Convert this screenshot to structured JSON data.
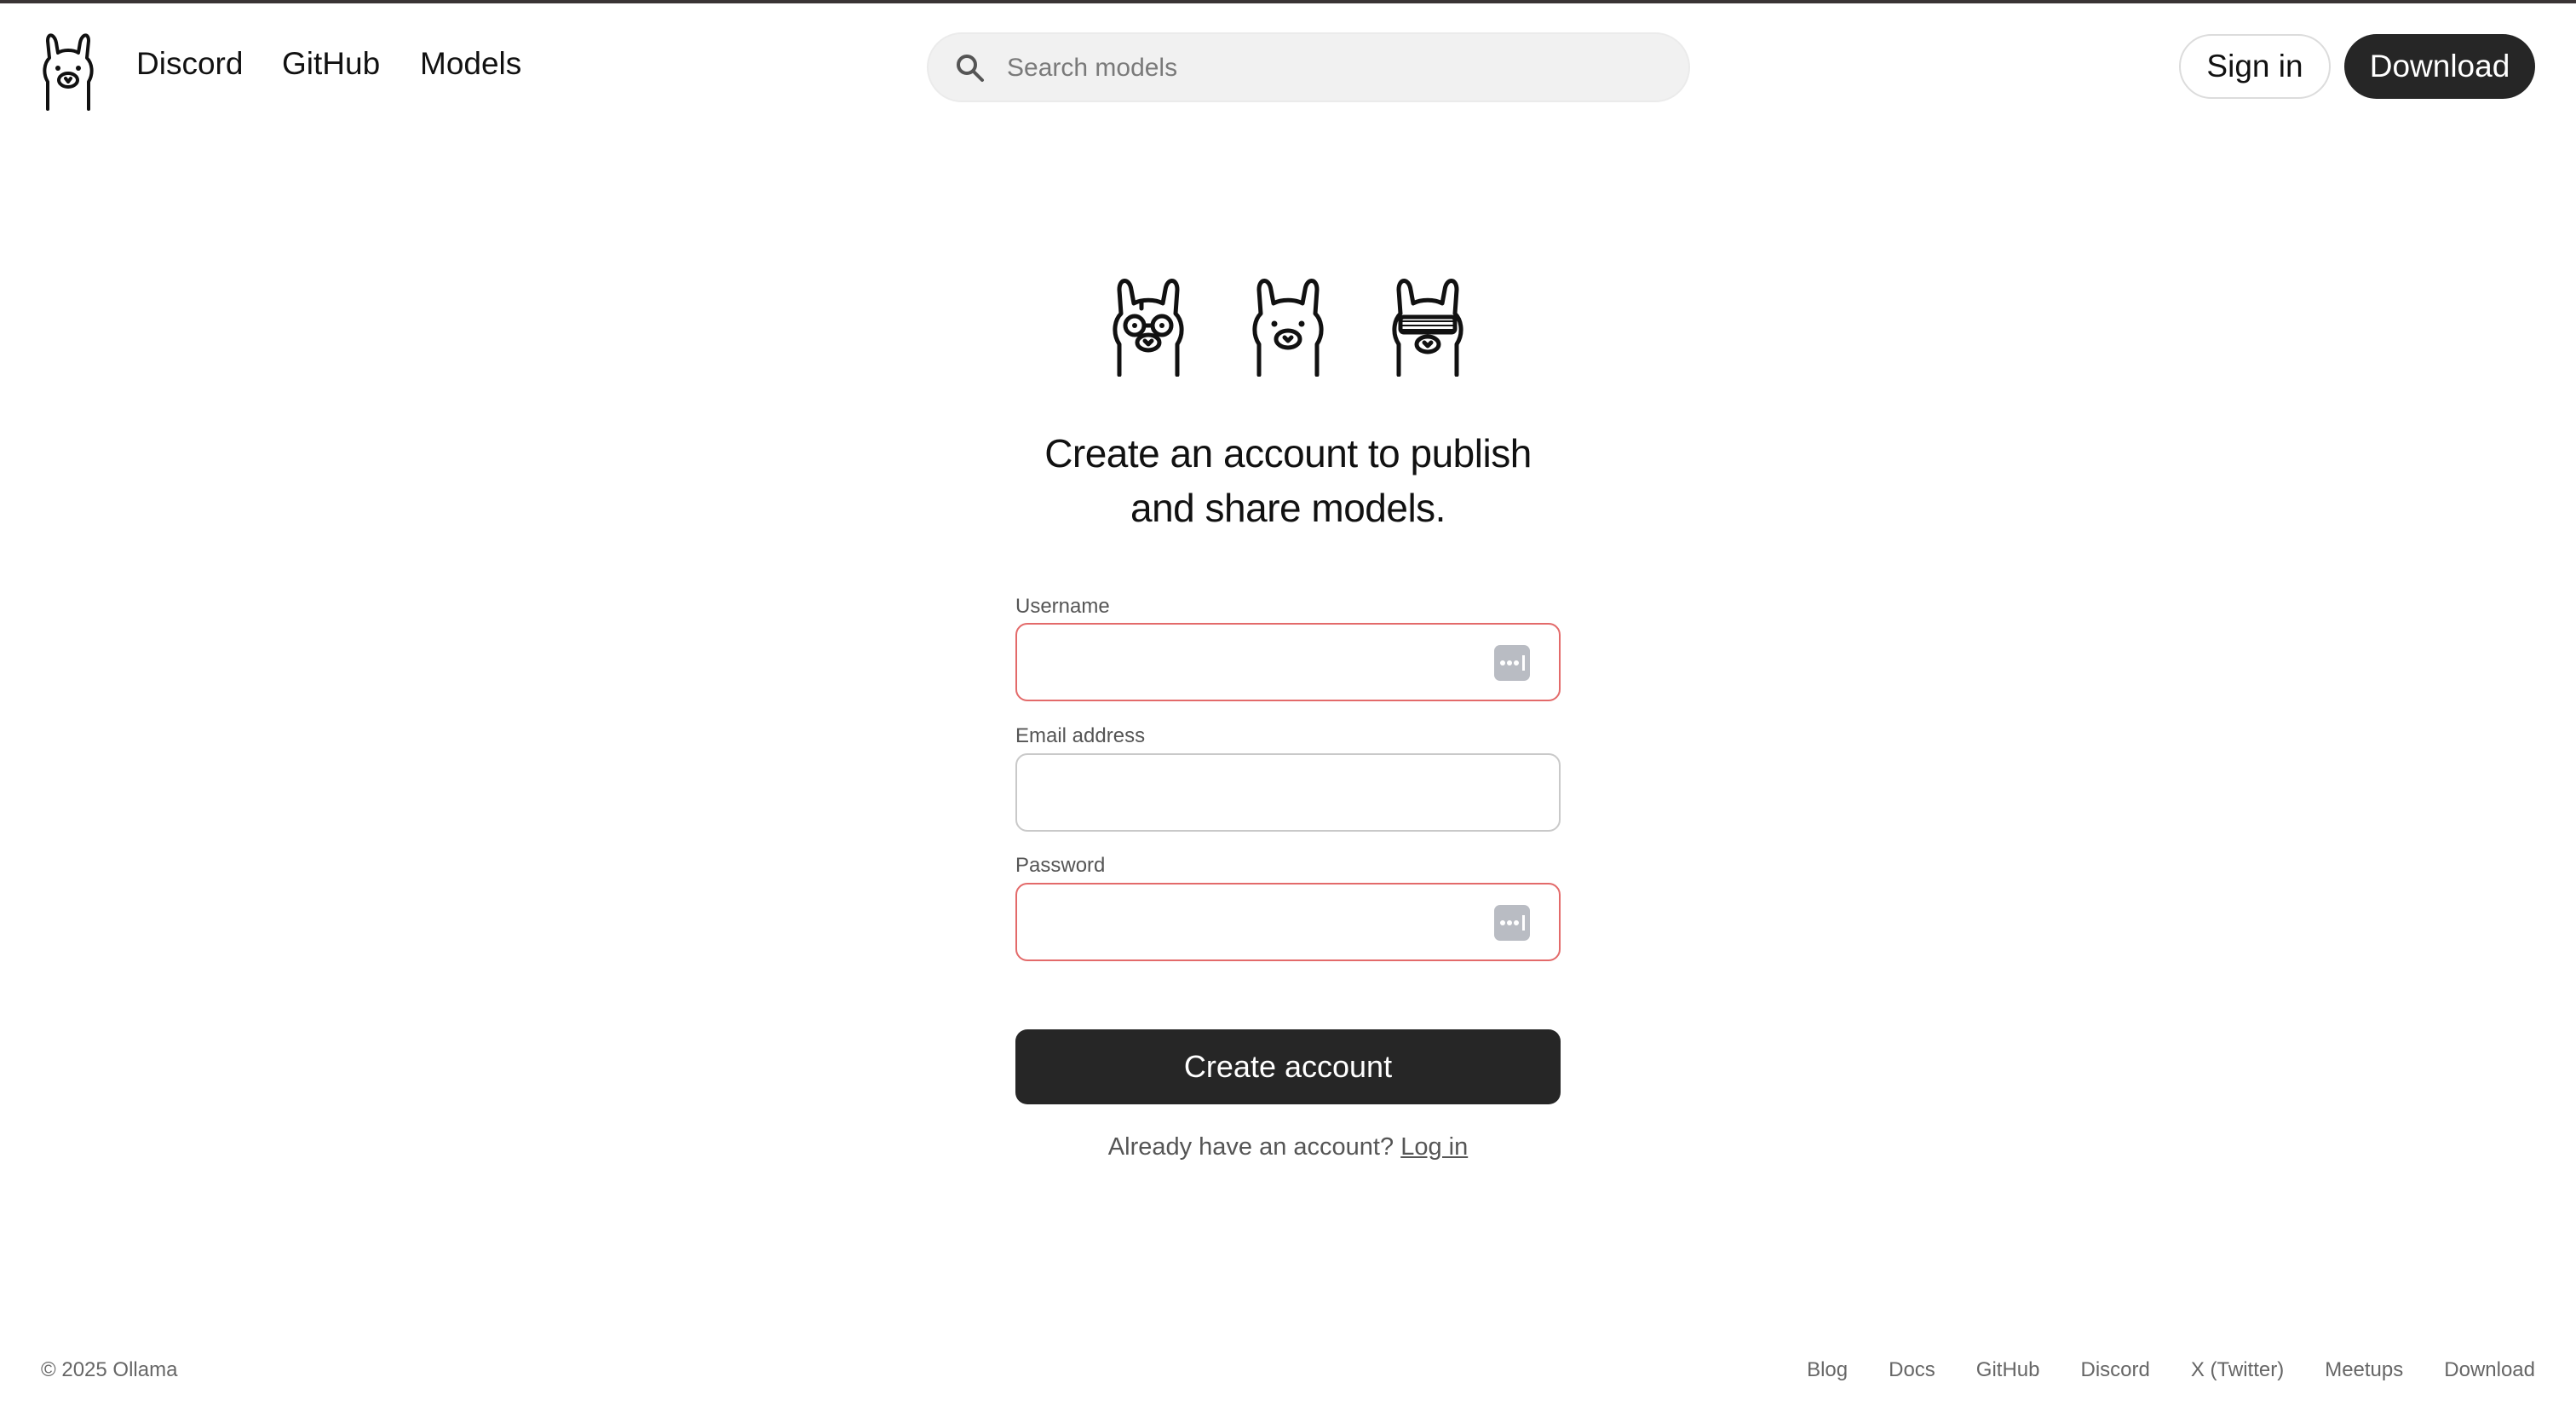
{
  "header": {
    "nav": [
      {
        "label": "Discord"
      },
      {
        "label": "GitHub"
      },
      {
        "label": "Models"
      }
    ],
    "search": {
      "placeholder": "Search models"
    },
    "sign_in_label": "Sign in",
    "download_label": "Download"
  },
  "main": {
    "heading_line1": "Create an account to publish",
    "heading_line2": "and share models.",
    "username_label": "Username",
    "username_value": "",
    "email_label": "Email address",
    "email_value": "",
    "password_label": "Password",
    "password_value": "",
    "create_button_label": "Create account",
    "already_text": "Already have an account?",
    "login_link_label": "Log in"
  },
  "footer": {
    "copyright": "© 2025 Ollama",
    "links": [
      {
        "label": "Blog"
      },
      {
        "label": "Docs"
      },
      {
        "label": "GitHub"
      },
      {
        "label": "Discord"
      },
      {
        "label": "X (Twitter)"
      },
      {
        "label": "Meetups"
      },
      {
        "label": "Download"
      }
    ]
  },
  "colors": {
    "accent_dark": "#262626",
    "error_border": "#e36a6a",
    "search_bg": "#f1f1f1"
  },
  "icons": [
    "ollama-logo-icon",
    "search-icon",
    "llama-glasses-icon",
    "llama-icon",
    "llama-shades-icon",
    "password-key-icon"
  ]
}
